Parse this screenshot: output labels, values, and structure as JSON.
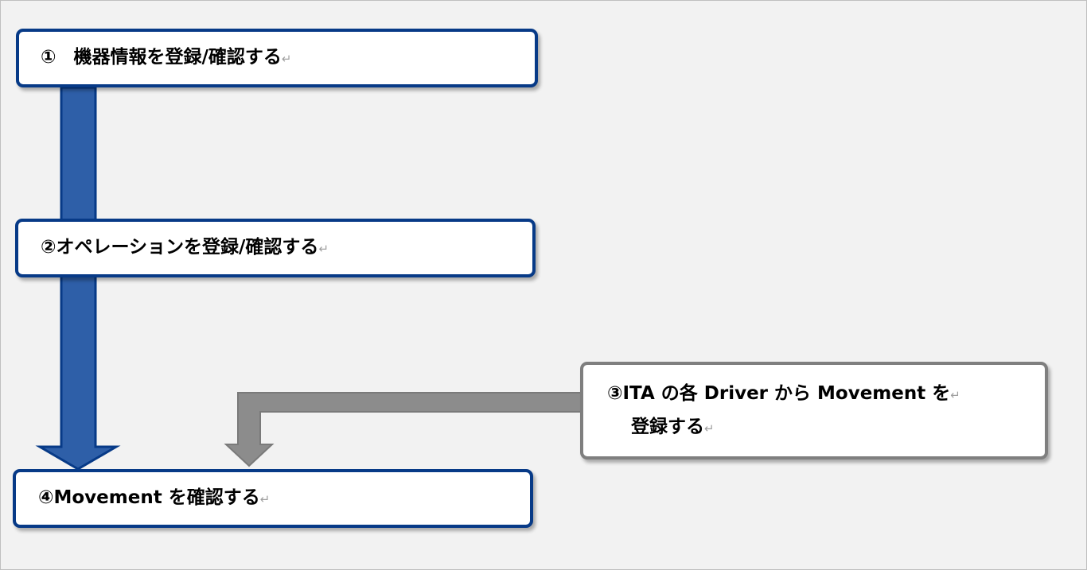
{
  "steps": [
    {
      "number": "①",
      "label": "機器情報を登録/確認する",
      "return_mark": "↵"
    },
    {
      "number": "②",
      "label": "オペレーションを登録/確認する",
      "return_mark": "↵"
    },
    {
      "number": "③",
      "line1": "ITA の各 Driver から Movement を",
      "line2": "登録する",
      "return_mark": "↵"
    },
    {
      "number": "④",
      "label": "Movement を確認する",
      "return_mark": "↵"
    }
  ],
  "colors": {
    "primary_border": "#073a87",
    "primary_arrow": "#2e5fa8",
    "secondary_border": "#7f7f7f",
    "secondary_arrow": "#8c8c8c",
    "background": "#f2f2f2"
  }
}
